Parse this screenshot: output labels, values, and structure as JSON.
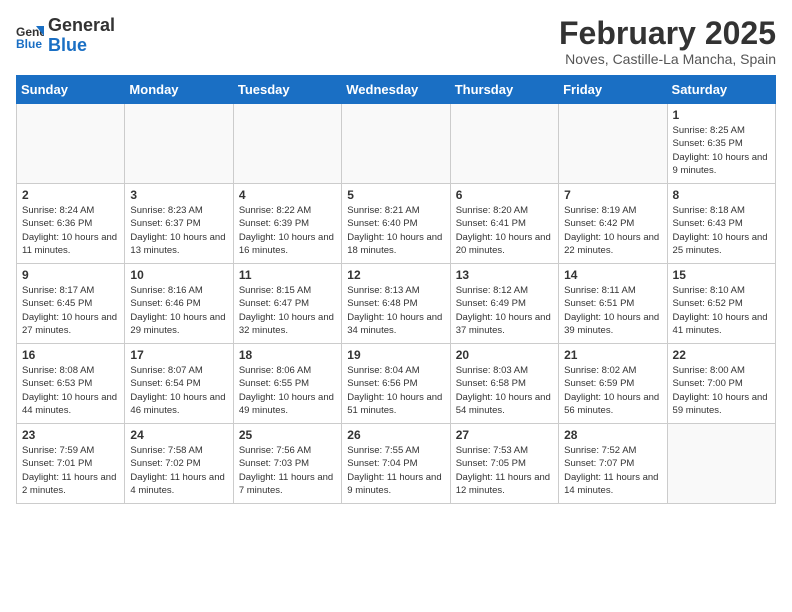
{
  "logo": {
    "general": "General",
    "blue": "Blue"
  },
  "title": "February 2025",
  "subtitle": "Noves, Castille-La Mancha, Spain",
  "days_of_week": [
    "Sunday",
    "Monday",
    "Tuesday",
    "Wednesday",
    "Thursday",
    "Friday",
    "Saturday"
  ],
  "weeks": [
    [
      {
        "day": "",
        "info": ""
      },
      {
        "day": "",
        "info": ""
      },
      {
        "day": "",
        "info": ""
      },
      {
        "day": "",
        "info": ""
      },
      {
        "day": "",
        "info": ""
      },
      {
        "day": "",
        "info": ""
      },
      {
        "day": "1",
        "info": "Sunrise: 8:25 AM\nSunset: 6:35 PM\nDaylight: 10 hours and 9 minutes."
      }
    ],
    [
      {
        "day": "2",
        "info": "Sunrise: 8:24 AM\nSunset: 6:36 PM\nDaylight: 10 hours and 11 minutes."
      },
      {
        "day": "3",
        "info": "Sunrise: 8:23 AM\nSunset: 6:37 PM\nDaylight: 10 hours and 13 minutes."
      },
      {
        "day": "4",
        "info": "Sunrise: 8:22 AM\nSunset: 6:39 PM\nDaylight: 10 hours and 16 minutes."
      },
      {
        "day": "5",
        "info": "Sunrise: 8:21 AM\nSunset: 6:40 PM\nDaylight: 10 hours and 18 minutes."
      },
      {
        "day": "6",
        "info": "Sunrise: 8:20 AM\nSunset: 6:41 PM\nDaylight: 10 hours and 20 minutes."
      },
      {
        "day": "7",
        "info": "Sunrise: 8:19 AM\nSunset: 6:42 PM\nDaylight: 10 hours and 22 minutes."
      },
      {
        "day": "8",
        "info": "Sunrise: 8:18 AM\nSunset: 6:43 PM\nDaylight: 10 hours and 25 minutes."
      }
    ],
    [
      {
        "day": "9",
        "info": "Sunrise: 8:17 AM\nSunset: 6:45 PM\nDaylight: 10 hours and 27 minutes."
      },
      {
        "day": "10",
        "info": "Sunrise: 8:16 AM\nSunset: 6:46 PM\nDaylight: 10 hours and 29 minutes."
      },
      {
        "day": "11",
        "info": "Sunrise: 8:15 AM\nSunset: 6:47 PM\nDaylight: 10 hours and 32 minutes."
      },
      {
        "day": "12",
        "info": "Sunrise: 8:13 AM\nSunset: 6:48 PM\nDaylight: 10 hours and 34 minutes."
      },
      {
        "day": "13",
        "info": "Sunrise: 8:12 AM\nSunset: 6:49 PM\nDaylight: 10 hours and 37 minutes."
      },
      {
        "day": "14",
        "info": "Sunrise: 8:11 AM\nSunset: 6:51 PM\nDaylight: 10 hours and 39 minutes."
      },
      {
        "day": "15",
        "info": "Sunrise: 8:10 AM\nSunset: 6:52 PM\nDaylight: 10 hours and 41 minutes."
      }
    ],
    [
      {
        "day": "16",
        "info": "Sunrise: 8:08 AM\nSunset: 6:53 PM\nDaylight: 10 hours and 44 minutes."
      },
      {
        "day": "17",
        "info": "Sunrise: 8:07 AM\nSunset: 6:54 PM\nDaylight: 10 hours and 46 minutes."
      },
      {
        "day": "18",
        "info": "Sunrise: 8:06 AM\nSunset: 6:55 PM\nDaylight: 10 hours and 49 minutes."
      },
      {
        "day": "19",
        "info": "Sunrise: 8:04 AM\nSunset: 6:56 PM\nDaylight: 10 hours and 51 minutes."
      },
      {
        "day": "20",
        "info": "Sunrise: 8:03 AM\nSunset: 6:58 PM\nDaylight: 10 hours and 54 minutes."
      },
      {
        "day": "21",
        "info": "Sunrise: 8:02 AM\nSunset: 6:59 PM\nDaylight: 10 hours and 56 minutes."
      },
      {
        "day": "22",
        "info": "Sunrise: 8:00 AM\nSunset: 7:00 PM\nDaylight: 10 hours and 59 minutes."
      }
    ],
    [
      {
        "day": "23",
        "info": "Sunrise: 7:59 AM\nSunset: 7:01 PM\nDaylight: 11 hours and 2 minutes."
      },
      {
        "day": "24",
        "info": "Sunrise: 7:58 AM\nSunset: 7:02 PM\nDaylight: 11 hours and 4 minutes."
      },
      {
        "day": "25",
        "info": "Sunrise: 7:56 AM\nSunset: 7:03 PM\nDaylight: 11 hours and 7 minutes."
      },
      {
        "day": "26",
        "info": "Sunrise: 7:55 AM\nSunset: 7:04 PM\nDaylight: 11 hours and 9 minutes."
      },
      {
        "day": "27",
        "info": "Sunrise: 7:53 AM\nSunset: 7:05 PM\nDaylight: 11 hours and 12 minutes."
      },
      {
        "day": "28",
        "info": "Sunrise: 7:52 AM\nSunset: 7:07 PM\nDaylight: 11 hours and 14 minutes."
      },
      {
        "day": "",
        "info": ""
      }
    ]
  ]
}
